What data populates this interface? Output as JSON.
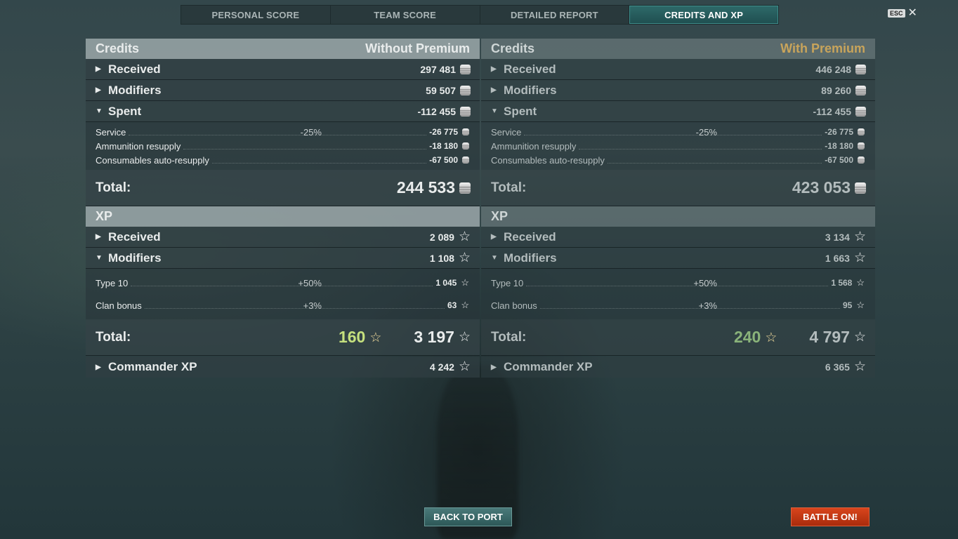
{
  "tabs": [
    {
      "label": "PERSONAL SCORE",
      "active": false
    },
    {
      "label": "TEAM SCORE",
      "active": false
    },
    {
      "label": "DETAILED REPORT",
      "active": false
    },
    {
      "label": "CREDITS AND XP",
      "active": true
    }
  ],
  "esc_label": "ESC",
  "left": {
    "credits_title": "Credits",
    "mode": "Without Premium",
    "received": {
      "label": "Received",
      "value": "297 481"
    },
    "modifiers": {
      "label": "Modifiers",
      "value": "59 507"
    },
    "spent": {
      "label": "Spent",
      "value": "-112 455"
    },
    "spent_items": [
      {
        "label": "Service",
        "pct": "-25%",
        "value": "-26 775"
      },
      {
        "label": "Ammunition resupply",
        "pct": "",
        "value": "-18 180"
      },
      {
        "label": "Consumables auto-resupply",
        "pct": "",
        "value": "-67 500"
      }
    ],
    "credits_total": {
      "label": "Total:",
      "value": "244 533"
    },
    "xp_title": "XP",
    "xp_received": {
      "label": "Received",
      "value": "2 089"
    },
    "xp_modifiers": {
      "label": "Modifiers",
      "value": "1 108"
    },
    "xp_items": [
      {
        "label": "Type 10",
        "pct": "+50%",
        "value": "1 045"
      },
      {
        "label": "Clan bonus",
        "pct": "+3%",
        "value": "63"
      }
    ],
    "xp_total": {
      "label": "Total:",
      "bonus": "160",
      "value": "3 197"
    },
    "commander": {
      "label": "Commander XP",
      "value": "4 242"
    }
  },
  "right": {
    "credits_title": "Credits",
    "mode": "With Premium",
    "received": {
      "label": "Received",
      "value": "446 248"
    },
    "modifiers": {
      "label": "Modifiers",
      "value": "89 260"
    },
    "spent": {
      "label": "Spent",
      "value": "-112 455"
    },
    "spent_items": [
      {
        "label": "Service",
        "pct": "-25%",
        "value": "-26 775"
      },
      {
        "label": "Ammunition resupply",
        "pct": "",
        "value": "-18 180"
      },
      {
        "label": "Consumables auto-resupply",
        "pct": "",
        "value": "-67 500"
      }
    ],
    "credits_total": {
      "label": "Total:",
      "value": "423 053"
    },
    "xp_title": "XP",
    "xp_received": {
      "label": "Received",
      "value": "3 134"
    },
    "xp_modifiers": {
      "label": "Modifiers",
      "value": "1 663"
    },
    "xp_items": [
      {
        "label": "Type 10",
        "pct": "+50%",
        "value": "1 568"
      },
      {
        "label": "Clan bonus",
        "pct": "+3%",
        "value": "95"
      }
    ],
    "xp_total": {
      "label": "Total:",
      "bonus": "240",
      "value": "4 797"
    },
    "commander": {
      "label": "Commander XP",
      "value": "6 365"
    }
  },
  "buttons": {
    "back": "BACK TO PORT",
    "battle": "BATTLE ON!"
  },
  "icons": {
    "credits": "credit-coin-icon",
    "xp": "star-icon",
    "expand": "triangle-right-icon",
    "collapse": "triangle-down-icon"
  },
  "colors": {
    "premium": "#c8a45b",
    "active_tab": "#2e6a6a",
    "battle_button": "#c9360f",
    "bonus_xp": "#c5e07e"
  }
}
